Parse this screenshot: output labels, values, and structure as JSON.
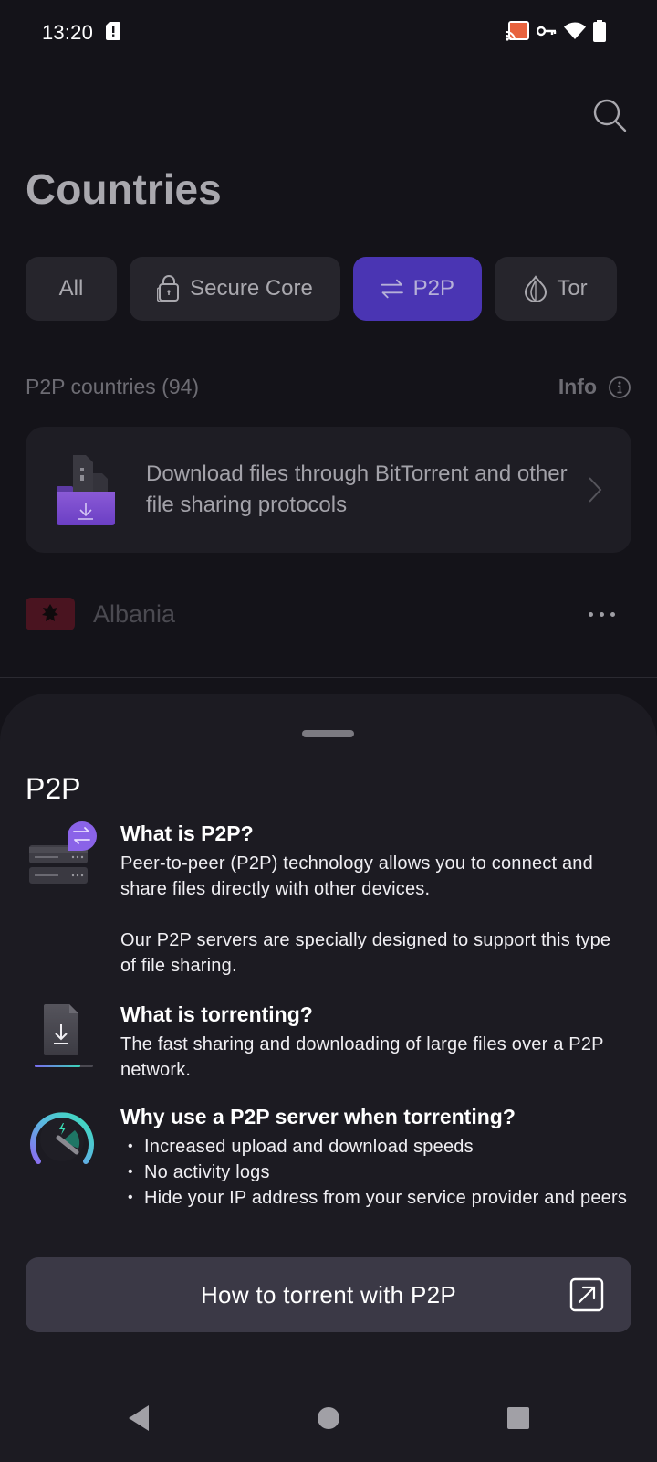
{
  "status_bar": {
    "time": "13:20",
    "left_icons": [
      "sim-alert-icon"
    ],
    "right_icons": [
      "cast-icon",
      "vpn-key-icon",
      "wifi-icon",
      "battery-icon"
    ],
    "cast_color": "#e8633f"
  },
  "header": {
    "title": "Countries",
    "search_icon": "search-icon"
  },
  "filters": [
    {
      "label": "All",
      "icon": null,
      "active": false
    },
    {
      "label": "Secure Core",
      "icon": "secure-core-lock-icon",
      "active": false
    },
    {
      "label": "P2P",
      "icon": "p2p-arrows-icon",
      "active": true
    },
    {
      "label": "Tor",
      "icon": "tor-onion-icon",
      "active": false
    }
  ],
  "section": {
    "label": "P2P countries (94)",
    "info_label": "Info",
    "info_icon": "info-circle-icon"
  },
  "promo": {
    "icon": "download-folder-icon",
    "text": "Download files through BitTorrent and other file sharing protocols",
    "chevron": "chevron-right-icon"
  },
  "countries": [
    {
      "name": "Albania",
      "flag": "albania-flag-icon",
      "more_icon": "more-horizontal-icon"
    }
  ],
  "sheet": {
    "title": "P2P",
    "items": [
      {
        "icon": "p2p-server-icon",
        "heading": "What is P2P?",
        "paragraphs": [
          "Peer-to-peer (P2P) technology allows you to connect and share files directly with other devices.",
          "Our P2P servers are specially designed to support this type of file sharing."
        ]
      },
      {
        "icon": "torrent-file-download-icon",
        "heading": "What is torrenting?",
        "paragraphs": [
          "The fast sharing and downloading of large files over a P2P network."
        ]
      },
      {
        "icon": "speedometer-icon",
        "heading": "Why use a P2P server when torrenting?",
        "bullets": [
          "Increased upload and download speeds",
          "No activity logs",
          "Hide your IP address from your service provider and peers"
        ]
      }
    ],
    "cta": {
      "label": "How to torrent with P2P",
      "icon": "external-link-icon"
    }
  },
  "nav_bar": {
    "back": "back-icon",
    "home": "home-icon",
    "recents": "recents-icon"
  },
  "colors": {
    "background": "#141319",
    "sheet": "#1c1b22",
    "accent": "#4a35b3",
    "chip": "#26252c",
    "cta": "#3b3946"
  }
}
